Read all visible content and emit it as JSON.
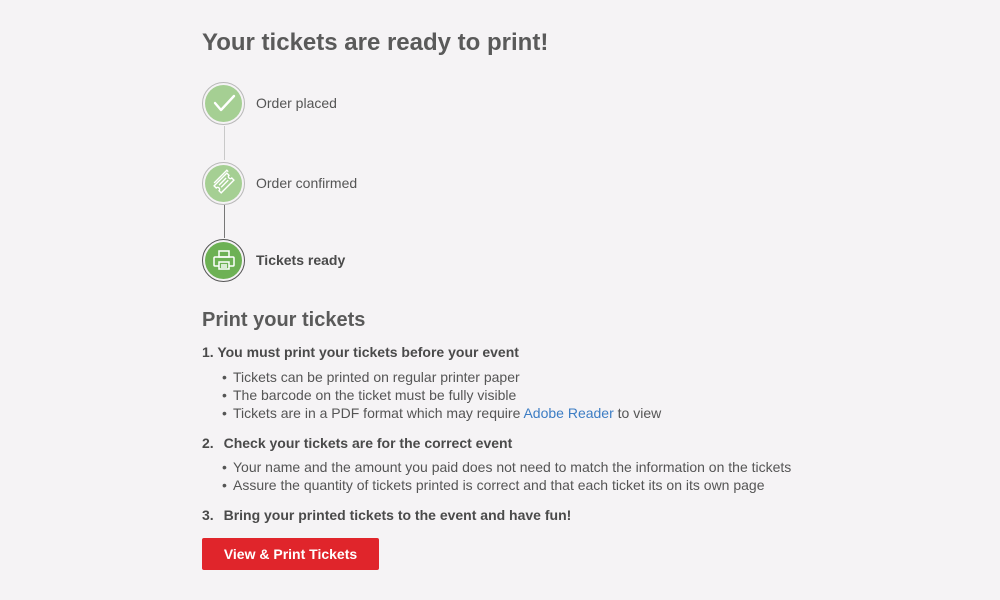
{
  "page_title": "Your tickets are ready to print!",
  "steps": [
    {
      "label": "Order placed",
      "icon": "checkmark-icon",
      "state": "completed"
    },
    {
      "label": "Order confirmed",
      "icon": "ticket-icon",
      "state": "completed"
    },
    {
      "label": "Tickets ready",
      "icon": "printer-icon",
      "state": "current"
    }
  ],
  "print_section": {
    "title": "Print your tickets",
    "instructions": [
      {
        "number": "1.",
        "heading": "You must print your tickets before your event",
        "bullets": [
          {
            "text": "Tickets can be printed on regular printer paper"
          },
          {
            "text": "The barcode on the ticket must be fully visible"
          },
          {
            "text_before": "Tickets are in a PDF format which may require ",
            "link_text": "Adobe Reader",
            "text_after": " to view"
          }
        ]
      },
      {
        "number": "2.",
        "heading": "Check your tickets are for the correct event",
        "bullets": [
          {
            "text": "Your name and the amount you paid does not need to match the information on the tickets"
          },
          {
            "text": "Assure the quantity of tickets printed is correct and that each ticket its on its own page"
          }
        ]
      },
      {
        "number": "3.",
        "heading": "Bring your printed tickets to the event and have fun!"
      }
    ],
    "bullet_char": "•"
  },
  "button": {
    "label": "View & Print Tickets"
  },
  "colors": {
    "background": "#f5f3f5",
    "step_completed": "#a5cf93",
    "step_current": "#6db154",
    "link": "#3d7dc4",
    "button": "#e0252b"
  }
}
